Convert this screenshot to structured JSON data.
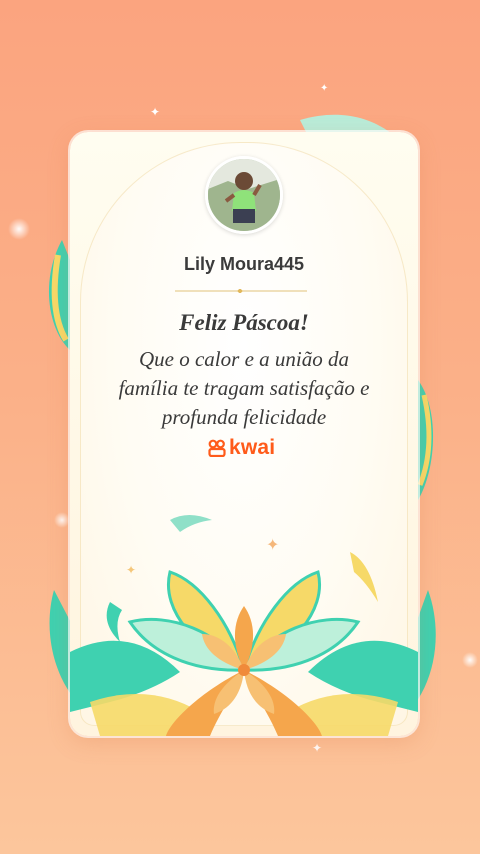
{
  "card": {
    "user_name": "Lily Moura445",
    "title": "Feliz Páscoa!",
    "message_lines": [
      "Que o calor e a união da",
      "família te tragam satisfação e",
      "profunda felicidade"
    ],
    "brand": "kwai"
  },
  "colors": {
    "background_top": "#fba47f",
    "background_bottom": "#fcc69c",
    "brand_orange": "#ff5b1a",
    "ribbon_teal": "#3fd1b0",
    "ribbon_yellow": "#f6d968",
    "petal_orange": "#f5a64c"
  },
  "icons": [
    "sparkle-icon",
    "kwai-logo-icon",
    "flower-decoration"
  ]
}
